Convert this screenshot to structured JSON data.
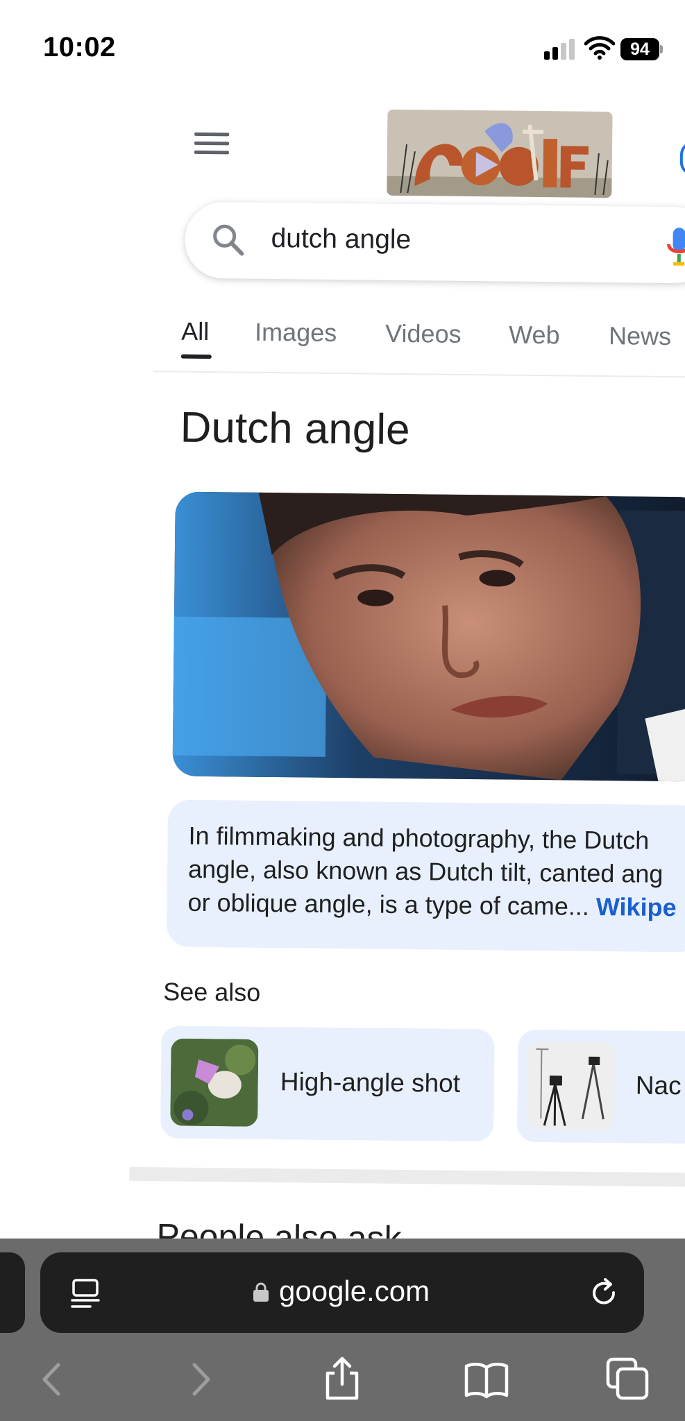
{
  "status_bar": {
    "time": "10:02",
    "battery": "94"
  },
  "search": {
    "query": "dutch angle"
  },
  "tabs": [
    {
      "label": "All",
      "active": true
    },
    {
      "label": "Images",
      "active": false
    },
    {
      "label": "Videos",
      "active": false
    },
    {
      "label": "Web",
      "active": false
    },
    {
      "label": "News",
      "active": false
    }
  ],
  "knowledge_panel": {
    "title": "Dutch angle",
    "description_lines": [
      "In filmmaking and photography, the Dutch",
      "angle, also known as Dutch tilt, canted ang",
      "or oblique angle, is a type of came..."
    ],
    "source_link": "Wikipe"
  },
  "see_also": {
    "heading": "See also",
    "items": [
      {
        "label": "High-angle shot"
      },
      {
        "label": "Nac"
      }
    ]
  },
  "people_also_ask": {
    "heading": "People also ask"
  },
  "browser": {
    "url": "google.com"
  },
  "colors": {
    "link_blue": "#1a5fce",
    "card_bg": "#e8f0fe",
    "toolbar_bg": "#6b6b6b",
    "address_bg": "#1f1f1f"
  }
}
